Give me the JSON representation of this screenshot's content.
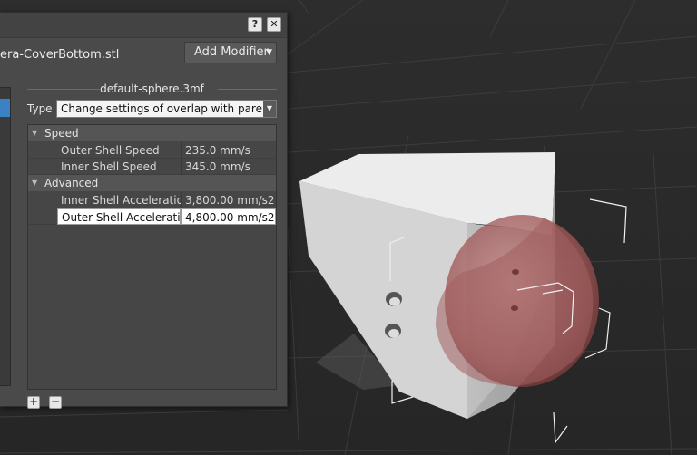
{
  "dialog": {
    "help_label": "?",
    "close_label": "✕",
    "object_file": "era-CoverBottom.stl",
    "add_modifier_label": "Add Modifier",
    "add_modifier_arrow": "▼",
    "section_title": "default-sphere.3mf",
    "type_label": "Type",
    "type_value": "Change settings of overlap with parent mo",
    "type_arrow": "▼",
    "add_button": "+",
    "remove_button": "−"
  },
  "settings": {
    "groups": [
      {
        "label": "Speed",
        "toggle": "▼",
        "items": [
          {
            "name": "Outer Shell Speed",
            "value": "235.0 mm/s"
          },
          {
            "name": "Inner Shell Speed",
            "value": "345.0 mm/s"
          }
        ]
      },
      {
        "label": "Advanced",
        "toggle": "▼",
        "items": [
          {
            "name": "Inner Shell Acceleration",
            "value": "3,800.00 mm/s2"
          },
          {
            "name": "Outer Shell Acceleration",
            "value": "4,800.00 mm/s2"
          }
        ]
      }
    ]
  },
  "colors": {
    "panel_bg": "#4a4a4a",
    "selection_blue": "#3b82c4",
    "model_grey": "#d6d6d6",
    "sphere_red": "#b46a6a"
  }
}
